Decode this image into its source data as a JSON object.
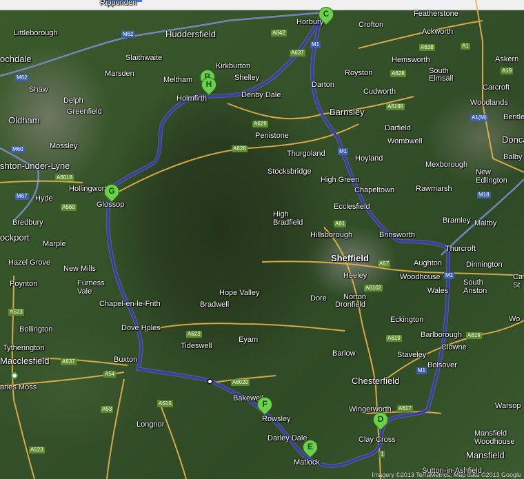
{
  "towns": [
    {
      "id": "rippenden",
      "text": "Ripponden"
    },
    {
      "id": "littleborough",
      "text": "Littleborough"
    },
    {
      "id": "huddersfield",
      "text": "Huddersfield"
    },
    {
      "id": "horbury",
      "text": "Horbury"
    },
    {
      "id": "crofton",
      "text": "Crofton"
    },
    {
      "id": "featherstone",
      "text": "Featherstone"
    },
    {
      "id": "ackworth",
      "text": "Ackworth"
    },
    {
      "id": "ochdale",
      "text": "ochdale"
    },
    {
      "id": "kirkburton",
      "text": "Kirkburton"
    },
    {
      "id": "slaithwaite",
      "text": "Slaithwaite"
    },
    {
      "id": "askern",
      "text": "Askern"
    },
    {
      "id": "marsden",
      "text": "Marsden"
    },
    {
      "id": "shelley",
      "text": "Shelley"
    },
    {
      "id": "royston",
      "text": "Royston"
    },
    {
      "id": "hemsworth",
      "text": "Hemsworth"
    },
    {
      "id": "meltham",
      "text": "Meltham"
    },
    {
      "id": "south-elmsall",
      "text": "South\nElmsall"
    },
    {
      "id": "shaw",
      "text": "Shaw"
    },
    {
      "id": "holmfirth",
      "text": "Holmfirth"
    },
    {
      "id": "denby-dale",
      "text": "Denby Dale"
    },
    {
      "id": "darton",
      "text": "Darton"
    },
    {
      "id": "cudworth",
      "text": "Cudworth"
    },
    {
      "id": "carcroft",
      "text": "Carcroft"
    },
    {
      "id": "delph",
      "text": "Delph"
    },
    {
      "id": "woodlands",
      "text": "Woodlands"
    },
    {
      "id": "barnsley",
      "text": "Barnsley"
    },
    {
      "id": "oldham",
      "text": "Oldham"
    },
    {
      "id": "bentley",
      "text": "Bentle"
    },
    {
      "id": "greenfield",
      "text": "Greenfield"
    },
    {
      "id": "darfield",
      "text": "Darfield"
    },
    {
      "id": "penistone",
      "text": "Penistone"
    },
    {
      "id": "doncaster",
      "text": "Donca"
    },
    {
      "id": "mossley",
      "text": "Mossley"
    },
    {
      "id": "thurgoland",
      "text": "Thurgoland"
    },
    {
      "id": "wombwell",
      "text": "Wombwell"
    },
    {
      "id": "balby",
      "text": "Balby"
    },
    {
      "id": "ashton",
      "text": "shton-under-Lyne"
    },
    {
      "id": "hoyland",
      "text": "Hoyland"
    },
    {
      "id": "stocksbridge",
      "text": "Stocksbridge"
    },
    {
      "id": "mexborough",
      "text": "Mexborough"
    },
    {
      "id": "new-edlington",
      "text": "New\nEdlington"
    },
    {
      "id": "hollingworth",
      "text": "Hollingworth"
    },
    {
      "id": "high-green",
      "text": "High Green"
    },
    {
      "id": "chapeltown",
      "text": "Chapeltown"
    },
    {
      "id": "rawmarsh",
      "text": "Rawmarsh"
    },
    {
      "id": "hyde",
      "text": "Hyde"
    },
    {
      "id": "glossop",
      "text": "Glossop"
    },
    {
      "id": "ecclesfield",
      "text": "Ecclesfield"
    },
    {
      "id": "bredbury",
      "text": "Bredbury"
    },
    {
      "id": "high-bradfield",
      "text": "High\nBradfield"
    },
    {
      "id": "bramley",
      "text": "Bramley"
    },
    {
      "id": "maltby",
      "text": "Maltby"
    },
    {
      "id": "brinsworth",
      "text": "Brinsworth"
    },
    {
      "id": "thurcroft",
      "text": "Thurcroft"
    },
    {
      "id": "ockport",
      "text": "ockport"
    },
    {
      "id": "hillsborough",
      "text": "Hillsborough"
    },
    {
      "id": "marple",
      "text": "Marple"
    },
    {
      "id": "sheffield",
      "text": "Sheffield"
    },
    {
      "id": "aughton",
      "text": "Aughton"
    },
    {
      "id": "dinnington",
      "text": "Dinnington"
    },
    {
      "id": "hazel-grove",
      "text": "Hazel Grove"
    },
    {
      "id": "new-mills",
      "text": "New Mills"
    },
    {
      "id": "heeley",
      "text": "Heeley"
    },
    {
      "id": "woodhouse",
      "text": "Woodhouse"
    },
    {
      "id": "poynton",
      "text": "Poynton"
    },
    {
      "id": "furness-vale",
      "text": "Furness\nVale"
    },
    {
      "id": "hope-valley",
      "text": "Hope Valley"
    },
    {
      "id": "south-anston",
      "text": "South\nAnston"
    },
    {
      "id": "wales",
      "text": "Wales"
    },
    {
      "id": "norton",
      "text": "Norton"
    },
    {
      "id": "dore",
      "text": "Dore"
    },
    {
      "id": "chapel",
      "text": "Chapel-en-le-Frith"
    },
    {
      "id": "bradwell",
      "text": "Bradwell"
    },
    {
      "id": "dronfield",
      "text": "Dronfield"
    },
    {
      "id": "bollington",
      "text": "Bollington"
    },
    {
      "id": "eckington",
      "text": "Eckington"
    },
    {
      "id": "dove-holes",
      "text": "Dove Holes"
    },
    {
      "id": "barlborough",
      "text": "Barlborough"
    },
    {
      "id": "tytherington",
      "text": "Tytherington"
    },
    {
      "id": "tideswell",
      "text": "Tideswell"
    },
    {
      "id": "eyam",
      "text": "Eyam"
    },
    {
      "id": "clowne",
      "text": "Clowne"
    },
    {
      "id": "barlow",
      "text": "Barlow"
    },
    {
      "id": "staveley",
      "text": "Staveley"
    },
    {
      "id": "macclesfield",
      "text": "Macclesfield"
    },
    {
      "id": "buxton",
      "text": "Buxton"
    },
    {
      "id": "chesterfield",
      "text": "Chesterfield"
    },
    {
      "id": "bolsover",
      "text": "Bolsover"
    },
    {
      "id": "anes-moss",
      "text": "anes Moss"
    },
    {
      "id": "bakewell",
      "text": "Bakewell"
    },
    {
      "id": "wingerworth",
      "text": "Wingerworth"
    },
    {
      "id": "warsop",
      "text": "Warsop"
    },
    {
      "id": "rowsley",
      "text": "Rowsley"
    },
    {
      "id": "longnor",
      "text": "Longnor"
    },
    {
      "id": "darley-dale",
      "text": "Darley Dale"
    },
    {
      "id": "clay-cross",
      "text": "Clay Cross"
    },
    {
      "id": "mansfield-woodhouse",
      "text": "Mansfield\nWoodhouse"
    },
    {
      "id": "matlock",
      "text": "Matlock"
    },
    {
      "id": "sutton",
      "text": "Sutton-in-Ashfield"
    },
    {
      "id": "mansfield",
      "text": "Mansfield"
    },
    {
      "id": "cas",
      "text": "Ca\nSt"
    },
    {
      "id": "wo",
      "text": "Wo"
    }
  ],
  "road_shields": [
    {
      "id": "m62a",
      "text": "M62",
      "type": "m"
    },
    {
      "id": "m62b",
      "text": "M62",
      "type": "m"
    },
    {
      "id": "a642",
      "text": "A642",
      "type": "a"
    },
    {
      "id": "a637",
      "text": "A637",
      "type": "a"
    },
    {
      "id": "m1a",
      "text": "M1",
      "type": "m"
    },
    {
      "id": "a638",
      "text": "A638",
      "type": "a"
    },
    {
      "id": "a1",
      "text": "A1",
      "type": "a"
    },
    {
      "id": "a628a",
      "text": "A628",
      "type": "a"
    },
    {
      "id": "a19",
      "text": "A19",
      "type": "a"
    },
    {
      "id": "a6195",
      "text": "A6195",
      "type": "a"
    },
    {
      "id": "a1m",
      "text": "A1(M)",
      "type": "a1m"
    },
    {
      "id": "a629",
      "text": "A629",
      "type": "a"
    },
    {
      "id": "m60",
      "text": "M60",
      "type": "m"
    },
    {
      "id": "a628b",
      "text": "A628",
      "type": "a"
    },
    {
      "id": "m1b",
      "text": "M1",
      "type": "m"
    },
    {
      "id": "a6018",
      "text": "A6018",
      "type": "a"
    },
    {
      "id": "m67",
      "text": "M67",
      "type": "m"
    },
    {
      "id": "a560",
      "text": "A560",
      "type": "a"
    },
    {
      "id": "m18",
      "text": "M18",
      "type": "m"
    },
    {
      "id": "a61",
      "text": "A61",
      "type": "a"
    },
    {
      "id": "a57",
      "text": "A57",
      "type": "a"
    },
    {
      "id": "m1c",
      "text": "M1",
      "type": "m"
    },
    {
      "id": "a6102",
      "text": "A6102",
      "type": "a"
    },
    {
      "id": "a523a",
      "text": "A523",
      "type": "a"
    },
    {
      "id": "a623",
      "text": "A623",
      "type": "a"
    },
    {
      "id": "a619a",
      "text": "A619",
      "type": "a"
    },
    {
      "id": "a537",
      "text": "A537",
      "type": "a"
    },
    {
      "id": "a619b",
      "text": "A619",
      "type": "a"
    },
    {
      "id": "m1d",
      "text": "M1",
      "type": "m"
    },
    {
      "id": "a54",
      "text": "A54",
      "type": "a"
    },
    {
      "id": "a6020",
      "text": "A6020",
      "type": "a"
    },
    {
      "id": "a515",
      "text": "A515",
      "type": "a"
    },
    {
      "id": "a617",
      "text": "A617",
      "type": "a"
    },
    {
      "id": "a53",
      "text": "A53",
      "type": "a"
    },
    {
      "id": "a523b",
      "text": "A523",
      "type": "a"
    },
    {
      "id": "a61b",
      "text": "1",
      "type": "a"
    }
  ],
  "markers": [
    {
      "id": "marker-b",
      "letter": "B"
    },
    {
      "id": "marker-h",
      "letter": "H"
    },
    {
      "id": "marker-c",
      "letter": "C"
    },
    {
      "id": "marker-g",
      "letter": "G"
    },
    {
      "id": "marker-f",
      "letter": "F"
    },
    {
      "id": "marker-d",
      "letter": "D"
    },
    {
      "id": "marker-e",
      "letter": "E"
    }
  ],
  "copyright": "Imagery ©2013 TerraMetrics, Map data ©2013 Google",
  "colors": {
    "route": "#3b3ba8",
    "route_glow": "#7d7dff",
    "motorway": "#7e8fd0",
    "a_road": "#e8b44a",
    "minor_road": "#d9c27a",
    "marker": "#6bd14b"
  }
}
